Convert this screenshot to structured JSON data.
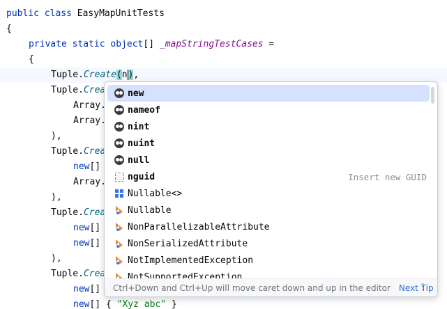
{
  "editor": {
    "lines": {
      "l1": {
        "kw1": "public",
        "kw2": "class",
        "name": "EasyMapUnitTests"
      },
      "l2": "{",
      "l3": {
        "kw1": "private",
        "kw2": "static",
        "kw3": "object",
        "brackets": "[]",
        "field": "_mapStringTestCases",
        "eq": " ="
      },
      "l4": "{",
      "l5": {
        "type": "Tuple.",
        "method": "Create",
        "open": "(",
        "typed": "n",
        "close": ")",
        "tail": ","
      },
      "l6": {
        "type": "Tuple.",
        "method": "Crea"
      },
      "l7": "Array.",
      "l8": "Array.",
      "l9": "),",
      "l10": {
        "type": "Tuple.",
        "method": "Crea"
      },
      "l11": {
        "kw": "new",
        "rest": "[]"
      },
      "l12": "Array.",
      "l13": "),",
      "l14": {
        "type": "Tuple.",
        "method": "Crea"
      },
      "l15": {
        "kw": "new",
        "rest": "[]"
      },
      "l16": {
        "kw": "new",
        "rest": "[]"
      },
      "l17": "),",
      "l18": {
        "type": "Tuple.",
        "method": "Crea"
      },
      "l19": {
        "kw": "new",
        "rest": "[]"
      },
      "l20": {
        "kw": "new",
        "rest": "[] { ",
        "str": "\"Xyz abc\"",
        "end": " }"
      }
    }
  },
  "completion": {
    "items": [
      {
        "match": "n",
        "rest": "ew",
        "icon": "keyword-icon",
        "bold": true
      },
      {
        "match": "n",
        "rest": "ameof",
        "icon": "keyword-icon",
        "bold": true
      },
      {
        "match": "n",
        "rest": "int",
        "icon": "keyword-icon",
        "bold": true
      },
      {
        "match": "n",
        "rest": "uint",
        "icon": "keyword-icon",
        "bold": true
      },
      {
        "match": "n",
        "rest": "ull",
        "icon": "keyword-icon",
        "bold": true
      },
      {
        "match": "n",
        "rest": "guid",
        "icon": "guid-template-icon",
        "bold": true,
        "hint": "Insert new GUID"
      },
      {
        "match": "N",
        "rest": "ullable<>",
        "icon": "struct-icon",
        "bold": false
      },
      {
        "match": "N",
        "rest": "ullable",
        "icon": "class-icon",
        "bold": false
      },
      {
        "match": "N",
        "rest": "onParallelizableAttribute",
        "icon": "class-icon",
        "bold": false
      },
      {
        "match": "N",
        "rest": "onSerializedAttribute",
        "icon": "class-icon",
        "bold": false
      },
      {
        "match": "N",
        "rest": "otImplementedException",
        "icon": "class-icon",
        "bold": false
      },
      {
        "match": "N",
        "rest": "otSupportedException",
        "icon": "class-icon",
        "bold": false
      }
    ],
    "footer": {
      "tip": "Ctrl+Down and Ctrl+Up will move caret down and up in the editor",
      "next_tip": "Next Tip",
      "more": "⋮"
    }
  },
  "colors": {
    "keyword": "#0033b3",
    "field": "#871094",
    "method": "#00627a",
    "string": "#067d17",
    "selection": "#d5e1ff",
    "link": "#2f6fde"
  }
}
